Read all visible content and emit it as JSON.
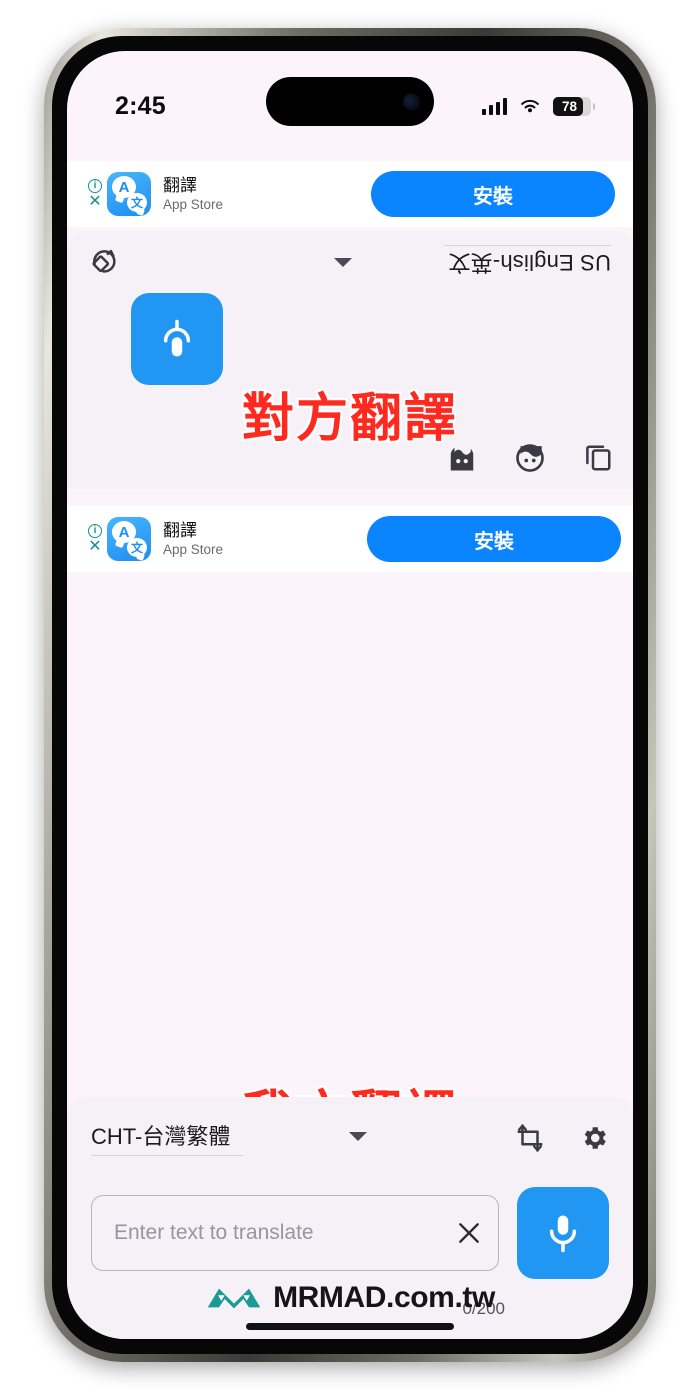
{
  "status_bar": {
    "time": "2:45",
    "signal_icon": "cellular-signal-icon",
    "wifi_icon": "wifi-icon",
    "battery_percent": "78",
    "battery_level": 78
  },
  "ads": [
    {
      "app_name": "翻譯",
      "source": "App Store",
      "install_label": "安裝",
      "info_icon": "i",
      "close_icon": "✕",
      "icon_letter_a": "A",
      "icon_letter_w": "文"
    },
    {
      "app_name": "翻譯",
      "source": "App Store",
      "install_label": "安裝",
      "info_icon": "i",
      "close_icon": "✕",
      "icon_letter_a": "A",
      "icon_letter_w": "文"
    }
  ],
  "remote_panel": {
    "language": "US English-英文",
    "mic_icon": "microphone-icon",
    "rotate_icon": "rotate-screen-icon",
    "caret_icon": "caret-up-icon",
    "toolbar_icons": [
      "copy-icon",
      "speech-bubble-icon",
      "shield-face-icon"
    ]
  },
  "local_panel": {
    "language": "CHT-台灣繁體",
    "caret_icon": "caret-down-icon",
    "crop_icon": "resize-crop-icon",
    "gear_icon": "gear-icon",
    "input_value": "",
    "input_placeholder": "Enter text to translate",
    "clear_icon": "close-x-icon",
    "mic_icon": "microphone-icon",
    "char_counter": "0/200"
  },
  "annotations": {
    "remote_label": "對方翻譯",
    "local_label": "我方翻譯"
  },
  "watermark": {
    "text": "MRMAD.com.tw",
    "logo_icon": "mrmad-logo-icon"
  },
  "colors": {
    "accent_blue": "#0a84ff",
    "mic_blue": "#2196f3",
    "panel_bg": "#f5f1f7",
    "screen_bg": "#fbf4fb",
    "annotation_red": "#ff2a1f",
    "watermark_teal": "#1a9a93"
  }
}
